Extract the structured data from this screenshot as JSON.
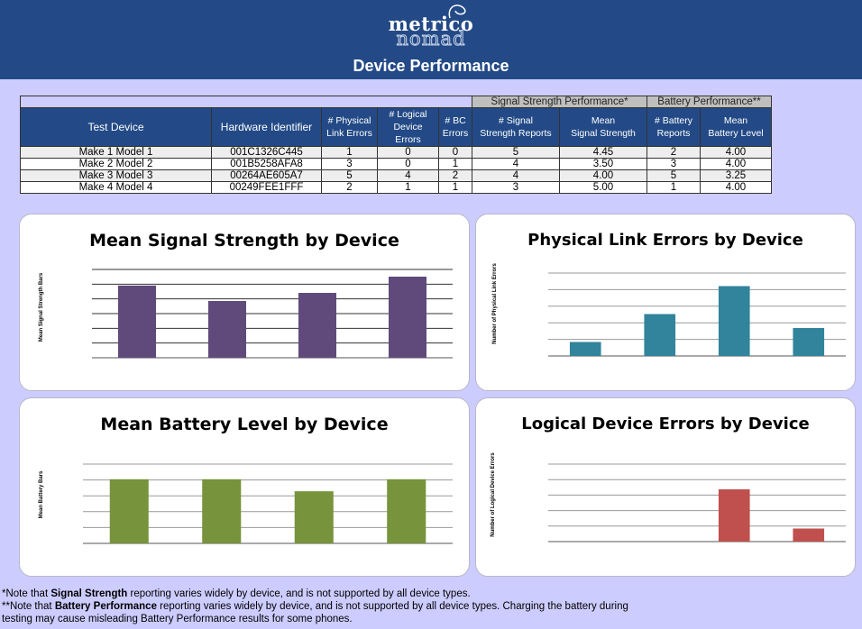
{
  "header": {
    "logo_top": "metrico",
    "logo_bottom": "nomad",
    "title": "Device Performance"
  },
  "table": {
    "groups": {
      "signal": "Signal Strength Performance*",
      "battery": "Battery Performance**"
    },
    "columns": [
      [
        "Test Device"
      ],
      [
        "Hardware Identifier"
      ],
      [
        "# Physical",
        "Link Errors"
      ],
      [
        "# Logical",
        "Device Errors"
      ],
      [
        "# BC",
        "Errors"
      ],
      [
        "# Signal",
        "Strength Reports"
      ],
      [
        "Mean",
        "Signal Strength"
      ],
      [
        "# Battery",
        "Reports"
      ],
      [
        "Mean",
        "Battery Level"
      ]
    ],
    "rows": [
      [
        "Make 1 Model 1",
        "001C1326C445",
        "1",
        "0",
        "0",
        "5",
        "4.45",
        "2",
        "4.00"
      ],
      [
        "Make 2 Model 2",
        "001B5258AFA8",
        "3",
        "0",
        "1",
        "4",
        "3.50",
        "3",
        "4.00"
      ],
      [
        "Make 3 Model 3",
        "00264AE605A7",
        "5",
        "4",
        "2",
        "4",
        "4.00",
        "5",
        "3.25"
      ],
      [
        "Make 4 Model 4",
        "00249FEE1FFF",
        "2",
        "1",
        "1",
        "3",
        "5.00",
        "1",
        "4.00"
      ]
    ]
  },
  "chart_data": [
    {
      "type": "bar",
      "title": "Mean Signal Strength by Device",
      "ylabel": "Mean Signal Strength Bars",
      "categories": [
        "Make 1 Model 1",
        "Make 2 Model 2",
        "Make 3 Model 3",
        "Make 4 Model 4"
      ],
      "values": [
        4.45,
        3.5,
        4.0,
        5.0
      ],
      "ylim": [
        0,
        5.5
      ],
      "grid": true,
      "color": "#604a7b"
    },
    {
      "type": "bar",
      "title": "Physical Link Errors by Device",
      "ylabel": "Number of Physical Link Errors",
      "categories": [
        "Make 1 Model 1",
        "Make 2 Model 2",
        "Make 3 Model 3",
        "Make 4 Model 4"
      ],
      "values": [
        1,
        3,
        5,
        2
      ],
      "ylim": [
        0,
        6
      ],
      "grid": true,
      "color": "#31849b"
    },
    {
      "type": "bar",
      "title": "Mean Battery Level by Device",
      "ylabel": "Mean Battery Bars",
      "categories": [
        "Make 1 Model 1",
        "Make 2 Model 2",
        "Make 3 Model 3",
        "Make 4 Model 4"
      ],
      "values": [
        4.0,
        4.0,
        3.25,
        4.0
      ],
      "ylim": [
        0,
        5
      ],
      "grid": true,
      "color": "#77933c"
    },
    {
      "type": "bar",
      "title": "Logical Device Errors by Device",
      "ylabel": "Number of Logical Device Errors",
      "categories": [
        "Make 1 Model 1",
        "Make 2 Model 2",
        "Make 3 Model 3",
        "Make 4 Model 4"
      ],
      "values": [
        0,
        0,
        4,
        1
      ],
      "ylim": [
        0,
        6
      ],
      "grid": true,
      "color": "#c0504d"
    }
  ],
  "notes": {
    "n1_pre": "*Note that ",
    "n1_bold": "Signal Strength",
    "n1_post": " reporting varies widely by device, and is not supported by all device types.",
    "n2_pre": "**Note that ",
    "n2_bold": "Battery Performance",
    "n2_post": " reporting varies widely by device, and is not supported by all device types.  Charging the battery during",
    "n3": "testing may cause misleading Battery Performance results for some phones."
  }
}
